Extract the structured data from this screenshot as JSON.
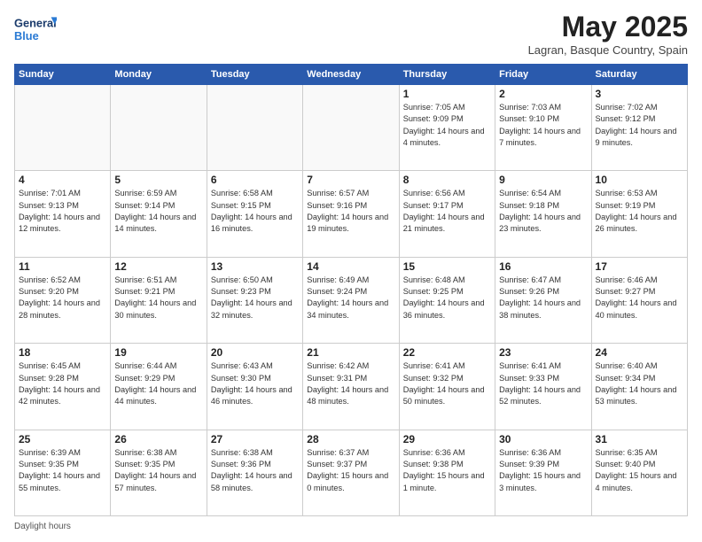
{
  "header": {
    "logo_line1": "General",
    "logo_line2": "Blue",
    "month_title": "May 2025",
    "subtitle": "Lagran, Basque Country, Spain"
  },
  "days_of_week": [
    "Sunday",
    "Monday",
    "Tuesday",
    "Wednesday",
    "Thursday",
    "Friday",
    "Saturday"
  ],
  "weeks": [
    [
      {
        "num": "",
        "info": ""
      },
      {
        "num": "",
        "info": ""
      },
      {
        "num": "",
        "info": ""
      },
      {
        "num": "",
        "info": ""
      },
      {
        "num": "1",
        "info": "Sunrise: 7:05 AM\nSunset: 9:09 PM\nDaylight: 14 hours\nand 4 minutes."
      },
      {
        "num": "2",
        "info": "Sunrise: 7:03 AM\nSunset: 9:10 PM\nDaylight: 14 hours\nand 7 minutes."
      },
      {
        "num": "3",
        "info": "Sunrise: 7:02 AM\nSunset: 9:12 PM\nDaylight: 14 hours\nand 9 minutes."
      }
    ],
    [
      {
        "num": "4",
        "info": "Sunrise: 7:01 AM\nSunset: 9:13 PM\nDaylight: 14 hours\nand 12 minutes."
      },
      {
        "num": "5",
        "info": "Sunrise: 6:59 AM\nSunset: 9:14 PM\nDaylight: 14 hours\nand 14 minutes."
      },
      {
        "num": "6",
        "info": "Sunrise: 6:58 AM\nSunset: 9:15 PM\nDaylight: 14 hours\nand 16 minutes."
      },
      {
        "num": "7",
        "info": "Sunrise: 6:57 AM\nSunset: 9:16 PM\nDaylight: 14 hours\nand 19 minutes."
      },
      {
        "num": "8",
        "info": "Sunrise: 6:56 AM\nSunset: 9:17 PM\nDaylight: 14 hours\nand 21 minutes."
      },
      {
        "num": "9",
        "info": "Sunrise: 6:54 AM\nSunset: 9:18 PM\nDaylight: 14 hours\nand 23 minutes."
      },
      {
        "num": "10",
        "info": "Sunrise: 6:53 AM\nSunset: 9:19 PM\nDaylight: 14 hours\nand 26 minutes."
      }
    ],
    [
      {
        "num": "11",
        "info": "Sunrise: 6:52 AM\nSunset: 9:20 PM\nDaylight: 14 hours\nand 28 minutes."
      },
      {
        "num": "12",
        "info": "Sunrise: 6:51 AM\nSunset: 9:21 PM\nDaylight: 14 hours\nand 30 minutes."
      },
      {
        "num": "13",
        "info": "Sunrise: 6:50 AM\nSunset: 9:23 PM\nDaylight: 14 hours\nand 32 minutes."
      },
      {
        "num": "14",
        "info": "Sunrise: 6:49 AM\nSunset: 9:24 PM\nDaylight: 14 hours\nand 34 minutes."
      },
      {
        "num": "15",
        "info": "Sunrise: 6:48 AM\nSunset: 9:25 PM\nDaylight: 14 hours\nand 36 minutes."
      },
      {
        "num": "16",
        "info": "Sunrise: 6:47 AM\nSunset: 9:26 PM\nDaylight: 14 hours\nand 38 minutes."
      },
      {
        "num": "17",
        "info": "Sunrise: 6:46 AM\nSunset: 9:27 PM\nDaylight: 14 hours\nand 40 minutes."
      }
    ],
    [
      {
        "num": "18",
        "info": "Sunrise: 6:45 AM\nSunset: 9:28 PM\nDaylight: 14 hours\nand 42 minutes."
      },
      {
        "num": "19",
        "info": "Sunrise: 6:44 AM\nSunset: 9:29 PM\nDaylight: 14 hours\nand 44 minutes."
      },
      {
        "num": "20",
        "info": "Sunrise: 6:43 AM\nSunset: 9:30 PM\nDaylight: 14 hours\nand 46 minutes."
      },
      {
        "num": "21",
        "info": "Sunrise: 6:42 AM\nSunset: 9:31 PM\nDaylight: 14 hours\nand 48 minutes."
      },
      {
        "num": "22",
        "info": "Sunrise: 6:41 AM\nSunset: 9:32 PM\nDaylight: 14 hours\nand 50 minutes."
      },
      {
        "num": "23",
        "info": "Sunrise: 6:41 AM\nSunset: 9:33 PM\nDaylight: 14 hours\nand 52 minutes."
      },
      {
        "num": "24",
        "info": "Sunrise: 6:40 AM\nSunset: 9:34 PM\nDaylight: 14 hours\nand 53 minutes."
      }
    ],
    [
      {
        "num": "25",
        "info": "Sunrise: 6:39 AM\nSunset: 9:35 PM\nDaylight: 14 hours\nand 55 minutes."
      },
      {
        "num": "26",
        "info": "Sunrise: 6:38 AM\nSunset: 9:35 PM\nDaylight: 14 hours\nand 57 minutes."
      },
      {
        "num": "27",
        "info": "Sunrise: 6:38 AM\nSunset: 9:36 PM\nDaylight: 14 hours\nand 58 minutes."
      },
      {
        "num": "28",
        "info": "Sunrise: 6:37 AM\nSunset: 9:37 PM\nDaylight: 15 hours\nand 0 minutes."
      },
      {
        "num": "29",
        "info": "Sunrise: 6:36 AM\nSunset: 9:38 PM\nDaylight: 15 hours\nand 1 minute."
      },
      {
        "num": "30",
        "info": "Sunrise: 6:36 AM\nSunset: 9:39 PM\nDaylight: 15 hours\nand 3 minutes."
      },
      {
        "num": "31",
        "info": "Sunrise: 6:35 AM\nSunset: 9:40 PM\nDaylight: 15 hours\nand 4 minutes."
      }
    ]
  ],
  "footer": {
    "daylight_label": "Daylight hours"
  }
}
